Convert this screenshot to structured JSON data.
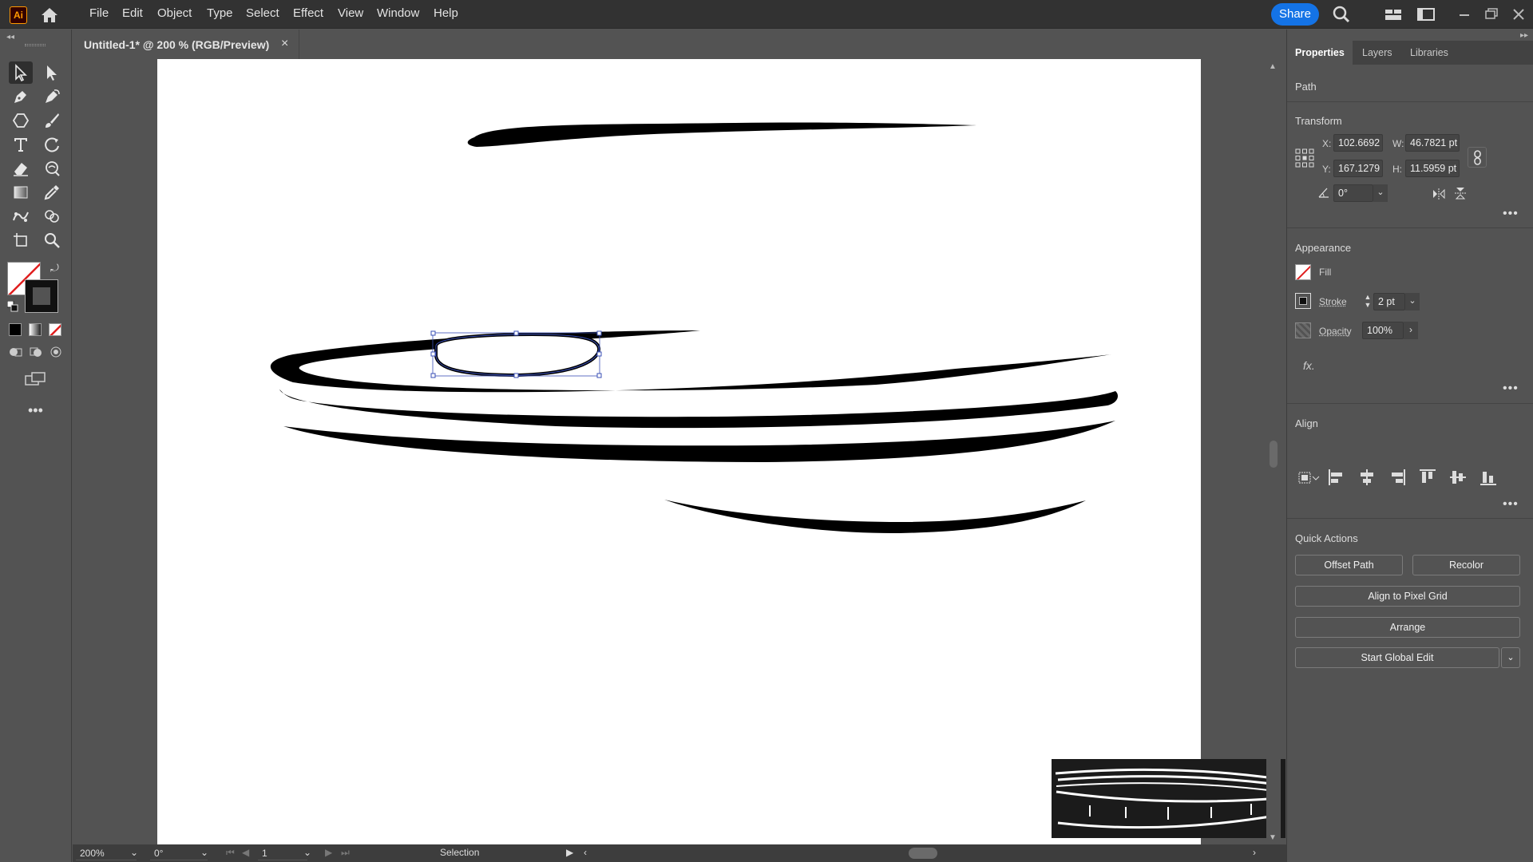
{
  "app": {
    "logo_text": "Ai",
    "brand_color": "#ff9a00",
    "accent_color": "#1473e6"
  },
  "menu": {
    "items": [
      "File",
      "Edit",
      "Object",
      "Type",
      "Select",
      "Effect",
      "View",
      "Window",
      "Help"
    ],
    "share_label": "Share"
  },
  "document": {
    "tab_title": "Untitled-1* @ 200 % (RGB/Preview)",
    "close_glyph": "×"
  },
  "status_bar": {
    "zoom": "200%",
    "rotation": "0°",
    "artboard": "1",
    "tool_name": "Selection"
  },
  "panel": {
    "tabs": [
      "Properties",
      "Layers",
      "Libraries"
    ],
    "object_type": "Path",
    "transform": {
      "title": "Transform",
      "x_label": "X:",
      "x_value": "102.6692 p",
      "y_label": "Y:",
      "y_value": "167.1279 p",
      "w_label": "W:",
      "w_value": "46.7821 pt",
      "h_label": "H:",
      "h_value": "11.5959 pt",
      "angle_value": "0°"
    },
    "appearance": {
      "title": "Appearance",
      "fill_label": "Fill",
      "stroke_label": "Stroke",
      "stroke_value": "2 pt",
      "opacity_label": "Opacity",
      "opacity_value": "100%",
      "fx_label": "fx."
    },
    "align": {
      "title": "Align"
    },
    "quick_actions": {
      "title": "Quick Actions",
      "offset_path": "Offset Path",
      "recolor": "Recolor",
      "align_pixel_grid": "Align to Pixel Grid",
      "arrange": "Arrange",
      "start_global_edit": "Start Global Edit"
    }
  },
  "icons": [
    "home-icon",
    "search-icon",
    "workspace-icon",
    "window-icon",
    "minimize-icon",
    "restore-icon",
    "close-icon",
    "selection-tool-icon",
    "direct-selection-tool-icon",
    "pen-tool-icon",
    "curvature-tool-icon",
    "shape-tool-icon",
    "paintbrush-tool-icon",
    "type-tool-icon",
    "rotate-tool-icon",
    "eraser-tool-icon",
    "warp-tool-icon",
    "gradient-tool-icon",
    "eyedropper-tool-icon",
    "puppet-warp-tool-icon",
    "shape-builder-tool-icon",
    "artboard-tool-icon",
    "zoom-tool-icon",
    "link-icon"
  ]
}
